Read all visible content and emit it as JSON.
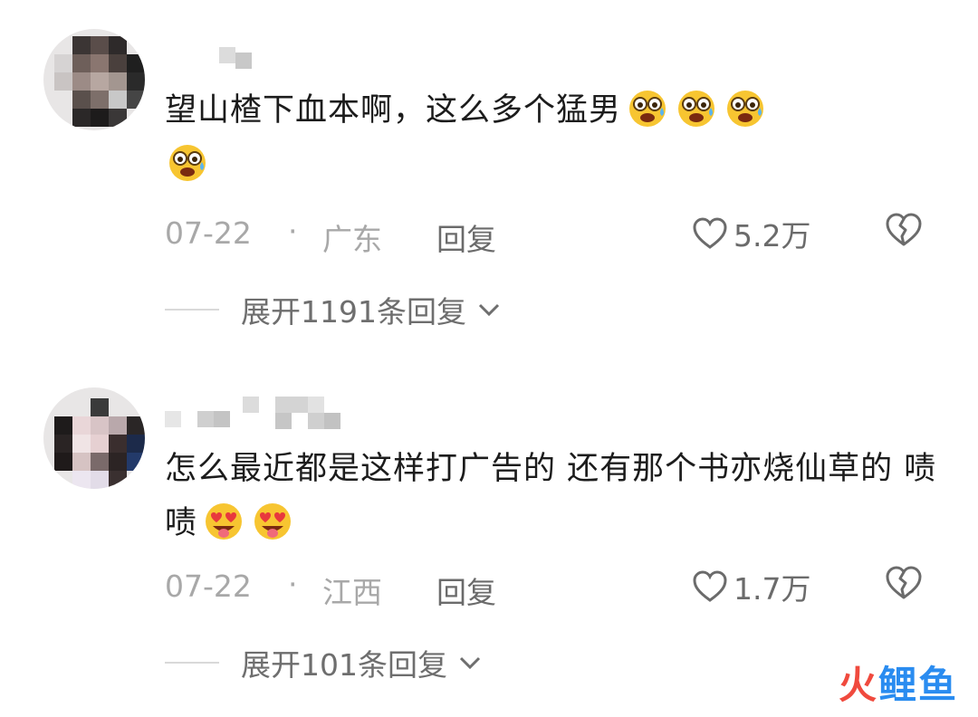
{
  "comments": [
    {
      "text": "望山楂下血本啊，这么多个猛男",
      "emoji": "crying-face-emoji",
      "emoji_count": 4,
      "date": "07-22",
      "separator": "·",
      "location": "广东",
      "reply_label": "回复",
      "likes": "5.2万",
      "expand_label": "展开1191条回复"
    },
    {
      "text": "怎么最近都是这样打广告的 还有那个书亦烧仙草的 啧啧",
      "emoji": "heart-eyes-tongue-emoji",
      "emoji_count": 2,
      "date": "07-22",
      "separator": "·",
      "location": "江西",
      "reply_label": "回复",
      "likes": "1.7万",
      "expand_label": "展开101条回复"
    }
  ],
  "watermark": {
    "fire": "火",
    "rest": "鲤鱼"
  },
  "colors": {
    "meta": "#a8a8a8",
    "action": "#6b6b6b",
    "text": "#1c1c1c",
    "watermark_red": "#f04a3e",
    "watermark_blue": "#2a8cf0"
  }
}
